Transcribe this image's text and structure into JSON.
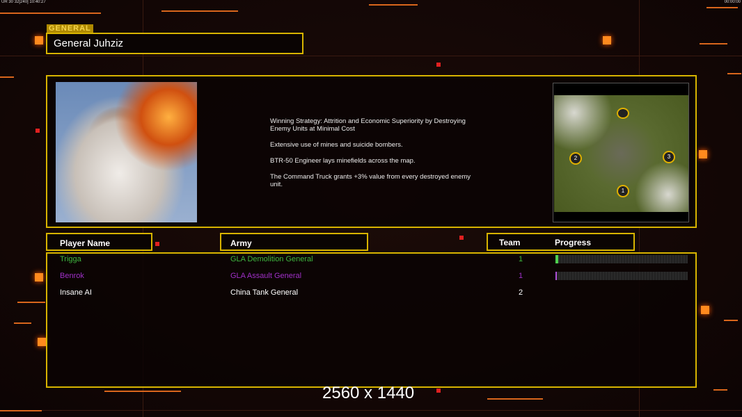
{
  "hud": {
    "top_left": "UR 30 32[240] 10:40:27",
    "top_right": "00:00:00"
  },
  "general_tag": "GENERAL",
  "general_name": "General Juhziz",
  "description": [
    "Winning Strategy: Attrition and Economic Superiority by Destroying\n Enemy Units at Minimal Cost",
    "Extensive use of mines and suicide bombers.",
    "BTR-50 Engineer lays minefields across the map.",
    "The Command Truck grants +3% value from every destroyed enemy\n unit."
  ],
  "map_markers": [
    "1",
    "2",
    "3"
  ],
  "columns": {
    "player": "Player Name",
    "army": "Army",
    "team": "Team",
    "progress": "Progress"
  },
  "players": [
    {
      "name": "Trigga",
      "army": "GLA Demolition General",
      "team": "1",
      "progress": 0.02,
      "color": "#3fb83f"
    },
    {
      "name": "Benrok",
      "army": "GLA Assault General",
      "team": "1",
      "progress": 0.01,
      "color": "#a030c8"
    },
    {
      "name": "Insane AI",
      "army": "China Tank General",
      "team": "2",
      "progress": null,
      "color": "#ffffff"
    }
  ],
  "resolution": "2560 x 1440"
}
